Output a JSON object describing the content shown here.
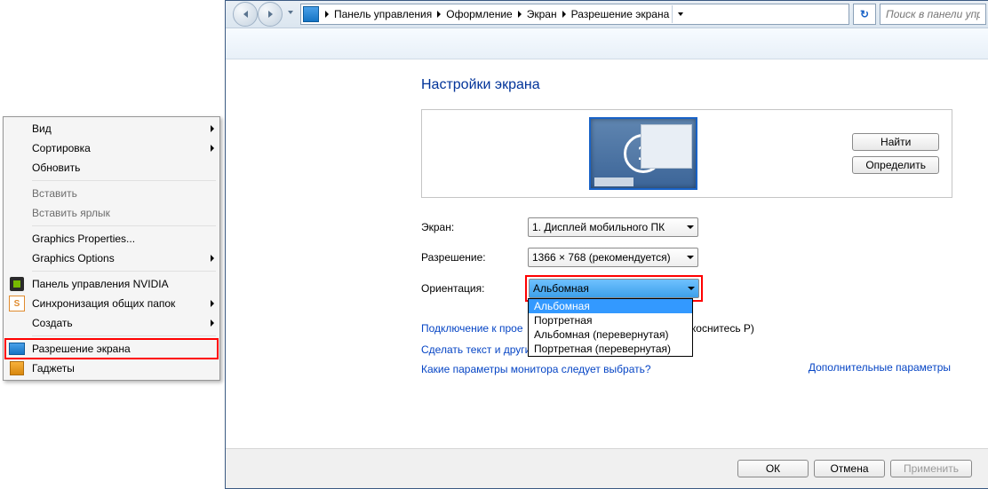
{
  "context_menu": {
    "items": [
      {
        "label": "Вид",
        "has_submenu": true
      },
      {
        "label": "Сортировка",
        "has_submenu": true
      },
      {
        "label": "Обновить"
      },
      "---",
      {
        "label": "Вставить",
        "disabled": true
      },
      {
        "label": "Вставить ярлык",
        "disabled": true
      },
      "---",
      {
        "label": "Graphics Properties..."
      },
      {
        "label": "Graphics Options",
        "has_submenu": true
      },
      "---",
      {
        "label": "Панель управления NVIDIA",
        "icon": "nvidia"
      },
      {
        "label": "Синхронизация общих папок",
        "icon": "sync",
        "has_submenu": true
      },
      {
        "label": "Создать",
        "has_submenu": true
      },
      "---",
      {
        "label": "Разрешение экрана",
        "icon": "monitor",
        "highlight": true
      },
      {
        "label": "Гаджеты",
        "icon": "gadget"
      }
    ]
  },
  "window": {
    "breadcrumb": [
      "Панель управления",
      "Оформление",
      "Экран",
      "Разрешение экрана"
    ],
    "search_placeholder": "Поиск в панели упра",
    "page_title": "Настройки экрана",
    "btn_find": "Найти",
    "btn_detect": "Определить",
    "monitor_number": "1",
    "label_display": "Экран:",
    "display_value": "1. Дисплей мобильного ПК",
    "label_resolution": "Разрешение:",
    "resolution_value": "1366 × 768 (рекомендуется)",
    "label_orientation": "Ориентация:",
    "orientation_value": "Альбомная",
    "orientation_options": [
      "Альбомная",
      "Портретная",
      "Альбомная (перевернутая)",
      "Портретная (перевернутая)"
    ],
    "adv_link": "Дополнительные параметры",
    "proj_text_left": "Подключение к прое",
    "proj_text_right": "и коснитесь P)",
    "link_text_size": "Сделать текст и другие элементы больше или меньше",
    "link_monitor_params": "Какие параметры монитора следует выбрать?",
    "btn_ok": "ОК",
    "btn_cancel": "Отмена",
    "btn_apply": "Применить"
  }
}
